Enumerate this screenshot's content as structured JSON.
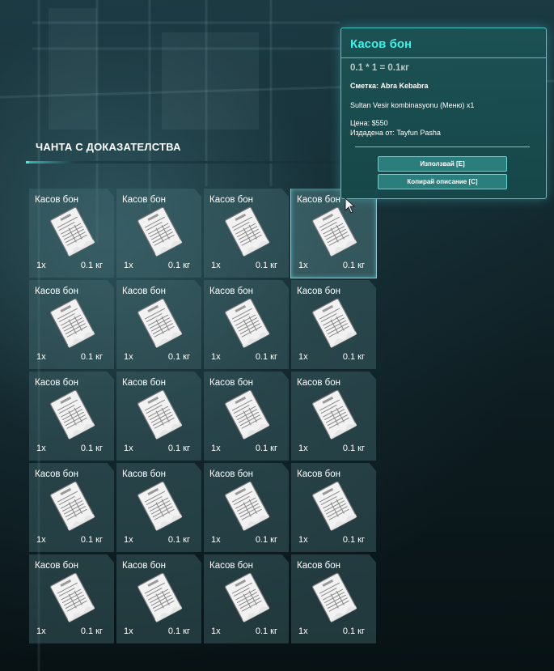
{
  "panel": {
    "title": "ЧАНТА С ДОКАЗАТЕЛСТВА"
  },
  "items": [
    {
      "name": "Касов бон",
      "count": "1x",
      "weight": "0.1 кг",
      "icon": "invoice-icon"
    },
    {
      "name": "Касов бон",
      "count": "1x",
      "weight": "0.1 кг",
      "icon": "invoice-icon"
    },
    {
      "name": "Касов бон",
      "count": "1x",
      "weight": "0.1 кг",
      "icon": "invoice-icon"
    },
    {
      "name": "Касов бон",
      "count": "1x",
      "weight": "0.1 кг",
      "icon": "invoice-icon",
      "selected": true
    },
    {
      "name": "Касов бон",
      "count": "1x",
      "weight": "0.1 кг",
      "icon": "invoice-icon"
    },
    {
      "name": "Касов бон",
      "count": "1x",
      "weight": "0.1 кг",
      "icon": "invoice-icon"
    },
    {
      "name": "Касов бон",
      "count": "1x",
      "weight": "0.1 кг",
      "icon": "invoice-icon"
    },
    {
      "name": "Касов бон",
      "count": "1x",
      "weight": "0.1 кг",
      "icon": "invoice-icon"
    },
    {
      "name": "Касов бон",
      "count": "1x",
      "weight": "0.1 кг",
      "icon": "invoice-icon"
    },
    {
      "name": "Касов бон",
      "count": "1x",
      "weight": "0.1 кг",
      "icon": "invoice-icon"
    },
    {
      "name": "Касов бон",
      "count": "1x",
      "weight": "0.1 кг",
      "icon": "invoice-icon"
    },
    {
      "name": "Касов бон",
      "count": "1x",
      "weight": "0.1 кг",
      "icon": "invoice-icon"
    },
    {
      "name": "Касов бон",
      "count": "1x",
      "weight": "0.1 кг",
      "icon": "invoice-icon"
    },
    {
      "name": "Касов бон",
      "count": "1x",
      "weight": "0.1 кг",
      "icon": "invoice-icon"
    },
    {
      "name": "Касов бон",
      "count": "1x",
      "weight": "0.1 кг",
      "icon": "invoice-icon"
    },
    {
      "name": "Касов бон",
      "count": "1x",
      "weight": "0.1 кг",
      "icon": "invoice-icon"
    },
    {
      "name": "Касов бон",
      "count": "1x",
      "weight": "0.1 кг",
      "icon": "invoice-icon"
    },
    {
      "name": "Касов бон",
      "count": "1x",
      "weight": "0.1 кг",
      "icon": "invoice-icon"
    },
    {
      "name": "Касов бон",
      "count": "1x",
      "weight": "0.1 кг",
      "icon": "invoice-icon"
    },
    {
      "name": "Касов бон",
      "count": "1x",
      "weight": "0.1 кг",
      "icon": "invoice-icon"
    }
  ],
  "tooltip": {
    "title": "Касов бон",
    "weight_formula": "0.1 * 1 = 0.1кг",
    "account_label": "Сметка: Abra Kebabra",
    "description": "Sultan Vesir kombinasyonu (Меню) x1",
    "price": "Цена: $550",
    "issued_by": "Издадена от: Tayfun Pasha",
    "use_button": "Използвай [E]",
    "copy_button": "Копирай описание [C]"
  },
  "colors": {
    "accent": "#3ff2e6",
    "slot_bg": "#46707a",
    "tooltip_bg": "#1c5254",
    "button_bg": "#2a7f7d"
  }
}
